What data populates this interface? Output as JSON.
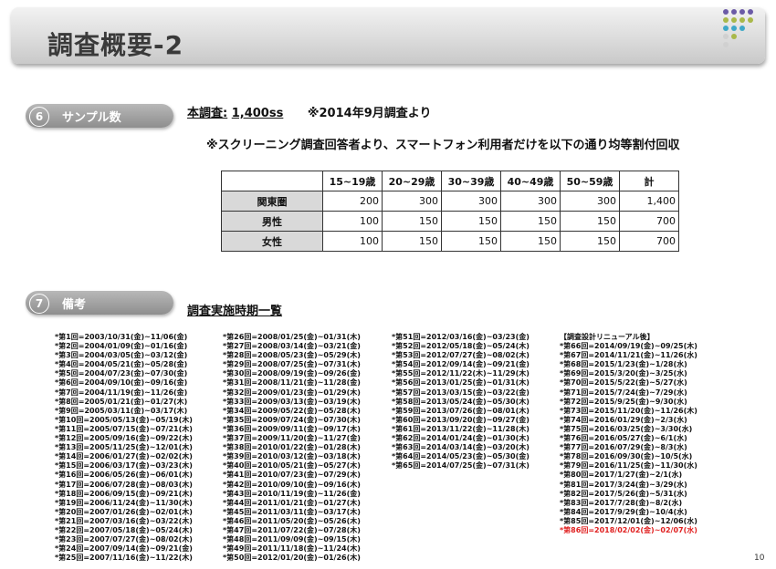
{
  "header": {
    "title": "調査概要-2",
    "logo_colors": [
      "#6b5aa6",
      "#a9b84a",
      "#3fa8c8",
      "#d0d0d0"
    ]
  },
  "section6": {
    "number": "6",
    "label": "サンプル数",
    "survey_label": "本調査:",
    "survey_count": "1,400ss",
    "survey_note": "※2014年9月調査より",
    "screening_note": "※スクリーニング調査回答者より、スマートフォン利用者だけを以下の通り均等割付回収",
    "table": {
      "headers": [
        "15~19歳",
        "20~29歳",
        "30~39歳",
        "40~49歳",
        "50~59歳",
        "計"
      ],
      "rows": [
        {
          "label": "関東圏",
          "values": [
            "200",
            "300",
            "300",
            "300",
            "300",
            "1,400"
          ]
        },
        {
          "label": "男性",
          "values": [
            "100",
            "150",
            "150",
            "150",
            "150",
            "700"
          ]
        },
        {
          "label": "女性",
          "values": [
            "100",
            "150",
            "150",
            "150",
            "150",
            "700"
          ]
        }
      ]
    }
  },
  "section7": {
    "number": "7",
    "label": "備考",
    "period_title": "調査実施時期一覧",
    "col1": [
      "*第1回=2003/10/31(金)~11/06(金)",
      "*第2回=2004/01/09(金)~01/16(金)",
      "*第3回=2004/03/05(金)~03/12(金)",
      "*第4回=2004/05/21(金)~05/28(金)",
      "*第5回=2004/07/23(金)~07/30(金)",
      "*第6回=2004/09/10(金)~09/16(金)",
      "*第7回=2004/11/19(金)~11/26(金)",
      "*第8回=2005/01/21(金)~01/27(木)",
      "*第9回=2005/03/11(金)~03/17(木)",
      "*第10回=2005/05/13(金)~05/19(木)",
      "*第11回=2005/07/15(金)~07/21(木)",
      "*第12回=2005/09/16(金)~09/22(木)",
      "*第13回=2005/11/25(金)~12/01(木)",
      "*第14回=2006/01/27(金)~02/02(木)",
      "*第15回=2006/03/17(金)~03/23(木)",
      "*第16回=2006/05/26(金)~06/01(木)",
      "*第17回=2006/07/28(金)~08/03(木)",
      "*第18回=2006/09/15(金)~09/21(木)",
      "*第19回=2006/11/24(金)~11/30(木)",
      "*第20回=2007/01/26(金)~02/01(木)",
      "*第21回=2007/03/16(金)~03/22(木)",
      "*第22回=2007/05/18(金)~05/24(木)",
      "*第23回=2007/07/27(金)~08/02(木)",
      "*第24回=2007/09/14(金)~09/21(金)",
      "*第25回=2007/11/16(金)~11/22(木)"
    ],
    "col2": [
      "*第26回=2008/01/25(金)~01/31(木)",
      "*第27回=2008/03/14(金)~03/21(金)",
      "*第28回=2008/05/23(金)~05/29(木)",
      "*第29回=2008/07/25(金)~07/31(木)",
      "*第30回=2008/09/19(金)~09/26(金)",
      "*第31回=2008/11/21(金)~11/28(金)",
      "*第32回=2009/01/23(金)~01/29(木)",
      "*第33回=2009/03/13(金)~03/19(木)",
      "*第34回=2009/05/22(金)~05/28(木)",
      "*第35回=2009/07/24(金)~07/30(木)",
      "*第36回=2009/09/11(金)~09/17(木)",
      "*第37回=2009/11/20(金)~11/27(金)",
      "*第38回=2010/01/22(金)~01/28(木)",
      "*第39回=2010/03/12(金)~03/18(木)",
      "*第40回=2010/05/21(金)~05/27(木)",
      "*第41回=2010/07/23(金)~07/29(木)",
      "*第42回=2010/09/10(金)~09/16(木)",
      "*第43回=2010/11/19(金)~11/26(金)",
      "*第44回=2011/01/21(金)~01/27(木)",
      "*第45回=2011/03/11(金)~03/17(木)",
      "*第46回=2011/05/20(金)~05/26(木)",
      "*第47回=2011/07/22(金)~07/28(木)",
      "*第48回=2011/09/09(金)~09/15(木)",
      "*第49回=2011/11/18(金)~11/24(木)",
      "*第50回=2012/01/20(金)~01/26(木)"
    ],
    "col3": [
      "*第51回=2012/03/16(金)~03/23(金)",
      "*第52回=2012/05/18(金)~05/24(木)",
      "*第53回=2012/07/27(金)~08/02(木)",
      "*第54回=2012/09/14(金)~09/21(金)",
      "*第55回=2012/11/22(木)~11/29(木)",
      "*第56回=2013/01/25(金)~01/31(木)",
      "*第57回=2013/03/15(金)~03/22(金)",
      "*第58回=2013/05/24(金)~05/30(木)",
      "*第59回=2013/07/26(金)~08/01(木)",
      "*第60回=2013/09/20(金)~09/27(金)",
      "*第61回=2013/11/22(金)~11/28(木)",
      "*第62回=2014/01/24(金)~01/30(木)",
      "*第63回=2014/03/14(金)~03/20(木)",
      "*第64回=2014/05/23(金)~05/30(金)",
      "*第65回=2014/07/25(金)~07/31(木)"
    ],
    "col4_heading": "【調査設計リニューアル後】",
    "col4": [
      "*第66回=2014/09/19(金)~09/25(木)",
      "*第67回=2014/11/21(金)~11/26(水)",
      "*第68回=2015/1/23(金)~1/28(水)",
      "*第69回=2015/3/20(金)~3/25(水)",
      "*第70回=2015/5/22(金)~5/27(水)",
      "*第71回=2015/7/24(金)~7/29(水)",
      "*第72回=2015/9/25(金)~9/30(水)",
      "*第73回=2015/11/20(金)~11/26(木)",
      "*第74回=2016/01/29(金)~2/3(水)",
      "*第75回=2016/03/25(金)~3/30(水)",
      "*第76回=2016/05/27(金)~6/1(水)",
      "*第77回=2016/07/29(金)~8/3(水)",
      "*第78回=2016/09/30(金)~10/5(水)",
      "*第79回=2016/11/25(金)~11/30(水)",
      "*第80回=2017/1/27(金)~2/1(水)",
      "*第81回=2017/3/24(金)~3/29(水)",
      "*第82回=2017/5/26(金)~5/31(水)",
      "*第83回=2017/7/28(金)~8/2(水)",
      "*第84回=2017/9/29(金)~10/4(水)",
      "*第85回=2017/12/01(金)~12/06(水)",
      "*第86回=2018/02/02(金)~02/07(水)"
    ],
    "highlight_color": "#e02020"
  },
  "footer": {
    "page_number": "10"
  }
}
